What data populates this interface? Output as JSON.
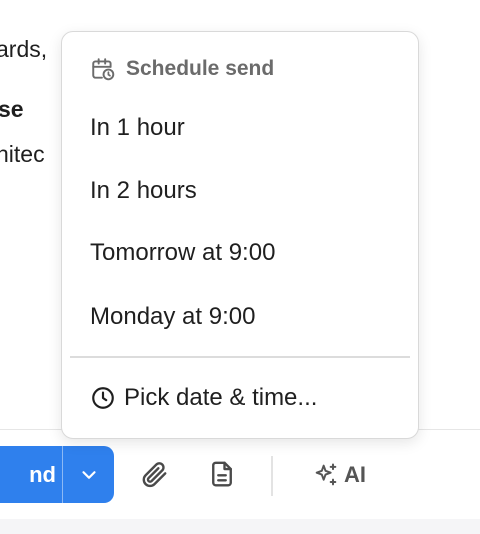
{
  "email_body": {
    "line1": "ards,",
    "line2": "se",
    "line3": "hitec"
  },
  "schedule_menu": {
    "header": "Schedule send",
    "options": [
      "In 1 hour",
      "In 2 hours",
      "Tomorrow at 9:00",
      "Monday at 9:00"
    ],
    "custom": "Pick date & time..."
  },
  "toolbar": {
    "send_label": "nd",
    "ai_label": "AI"
  },
  "colors": {
    "send_accent": "#2f80ed",
    "muted_text": "#6b6b6b",
    "divider": "#dcdcdc"
  },
  "icons": [
    "calendar-clock-icon",
    "clock-icon",
    "chevron-down-icon",
    "paperclip-icon",
    "document-icon",
    "sparkles-icon"
  ]
}
